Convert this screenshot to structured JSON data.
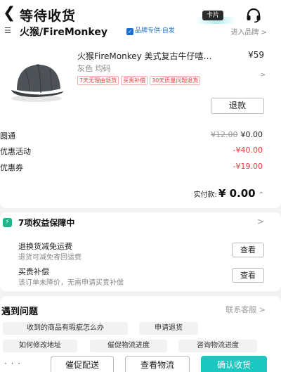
{
  "header": {
    "back_icon": "chevron-left-icon",
    "title": "等待收货",
    "card_tag": "卡片",
    "service_icon": "headset-icon"
  },
  "store": {
    "name": "火猴/FireMonkey",
    "badge": "品牌专供·自发",
    "enter_link": "进入品牌 >"
  },
  "product": {
    "title": "火猴FireMonkey 美式复古牛仔嘻…",
    "price": "¥59",
    "spec": "灰色 均码",
    "tags": [
      "7天无理由退货",
      "买贵补偿",
      "30天质量问题退货"
    ],
    "refund_label": "退款"
  },
  "price_rows": [
    {
      "label": "圆通",
      "old": "¥12.00",
      "value": "¥0.00",
      "tone": "normal"
    },
    {
      "label": "优惠活动",
      "old": "",
      "value": "-¥40.00",
      "tone": "red"
    },
    {
      "label": "优惠券",
      "old": "",
      "value": "-¥19.00",
      "tone": "red"
    }
  ],
  "paid": {
    "label": "实付款:",
    "value": "¥ 0.00"
  },
  "rights": {
    "title": "7项权益保障中",
    "items": [
      {
        "title": "退换货减免运费",
        "desc": "退货可减免寄回运费",
        "button": "查看"
      },
      {
        "title": "买贵补偿",
        "desc": "该订单未降价，无需申请买贵补偿",
        "button": "查看"
      }
    ]
  },
  "problems": {
    "title": "遇到问题",
    "contact": "联系客服 >",
    "chips": [
      "收到的商品有瑕疵怎么办",
      "申请退货",
      "如何修改地址",
      "催促物流进度",
      "咨询物流进度"
    ]
  },
  "bottom_bar": {
    "more": "· · ·",
    "buttons": [
      "催促配送",
      "查看物流",
      "确认收货"
    ]
  },
  "colors": {
    "accent": "#1cc7c0",
    "price_red": "#e4393c",
    "brand_blue": "#1b6fcf",
    "rights_green": "#1fb58a"
  }
}
